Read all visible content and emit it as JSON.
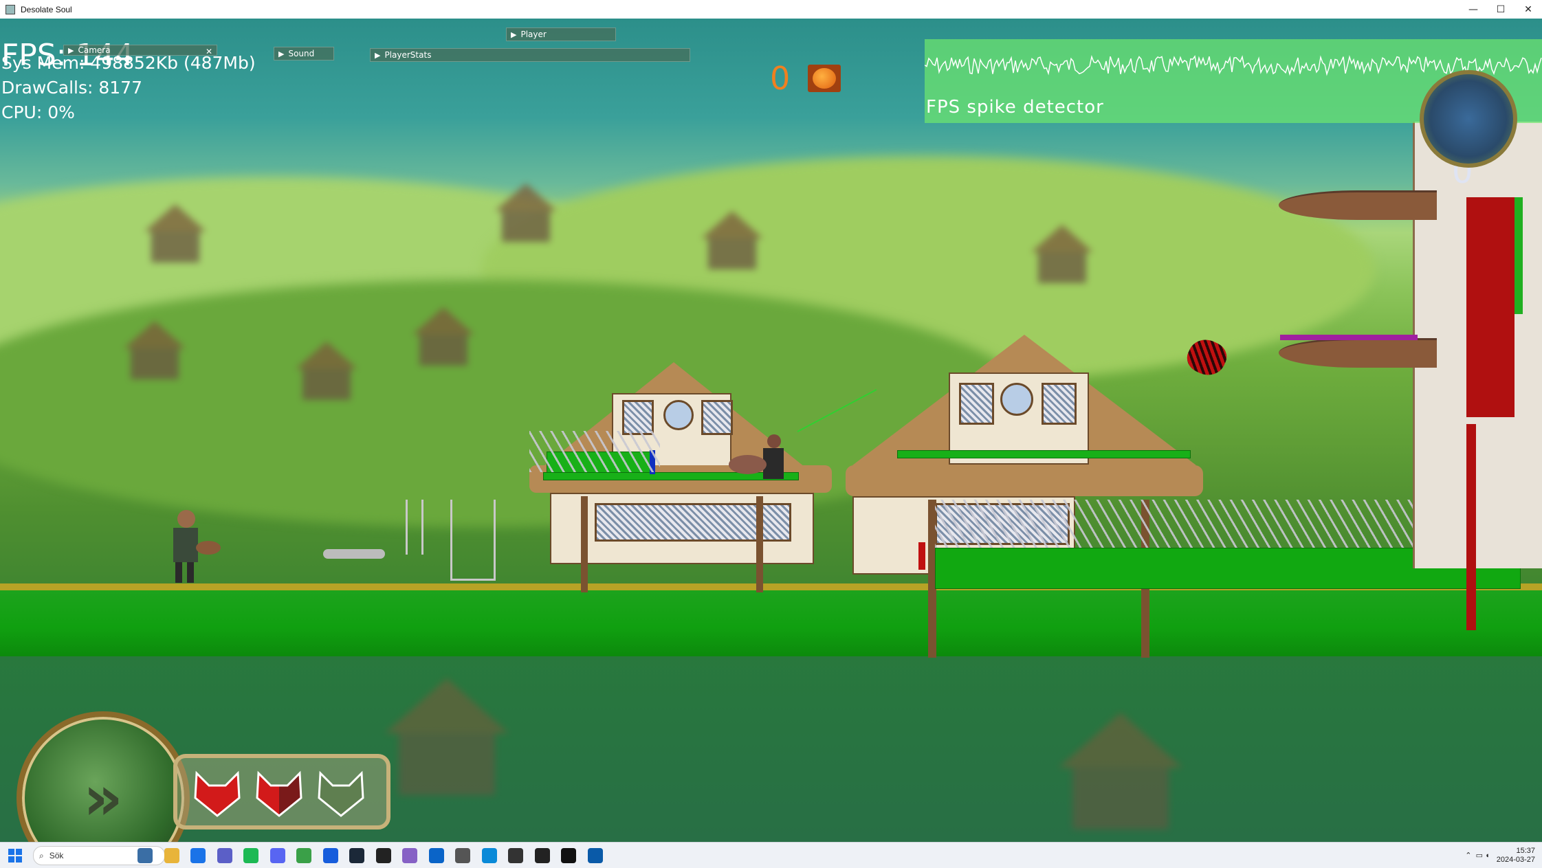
{
  "window": {
    "title": "Desolate Soul",
    "controls": [
      "—",
      "☐",
      "✕"
    ]
  },
  "debug": {
    "fps": "FPS: 144",
    "sys_mem": "Sys Mem: 498852Kb (487Mb)",
    "draw_calls": "DrawCalls: 8177",
    "cpu": "CPU: 0%"
  },
  "panels": {
    "camera": "Camera",
    "sound": "Sound",
    "player_stats": "PlayerStats",
    "player": "Player"
  },
  "hud": {
    "score": "0",
    "fps_spike_label": "FPS spike detector",
    "tower_counter": "0"
  },
  "lives": {
    "full": 1,
    "half": 1,
    "empty": 1
  },
  "taskbar": {
    "search_placeholder": "Sök",
    "time": "15:37",
    "date": "2024-03-27",
    "apps": [
      "widgets",
      "file-explorer",
      "chrome",
      "teams",
      "spotify",
      "discord",
      "notepad",
      "bitwarden",
      "steam",
      "unity",
      "visual-studio",
      "outlook",
      "calculator",
      "vpn",
      "terminal-app",
      "github",
      "cmd",
      "desolate-soul"
    ]
  },
  "colors": {
    "debug_green": "#18b018",
    "score_orange": "#f08020",
    "spike_bg": "#6ee66e"
  }
}
